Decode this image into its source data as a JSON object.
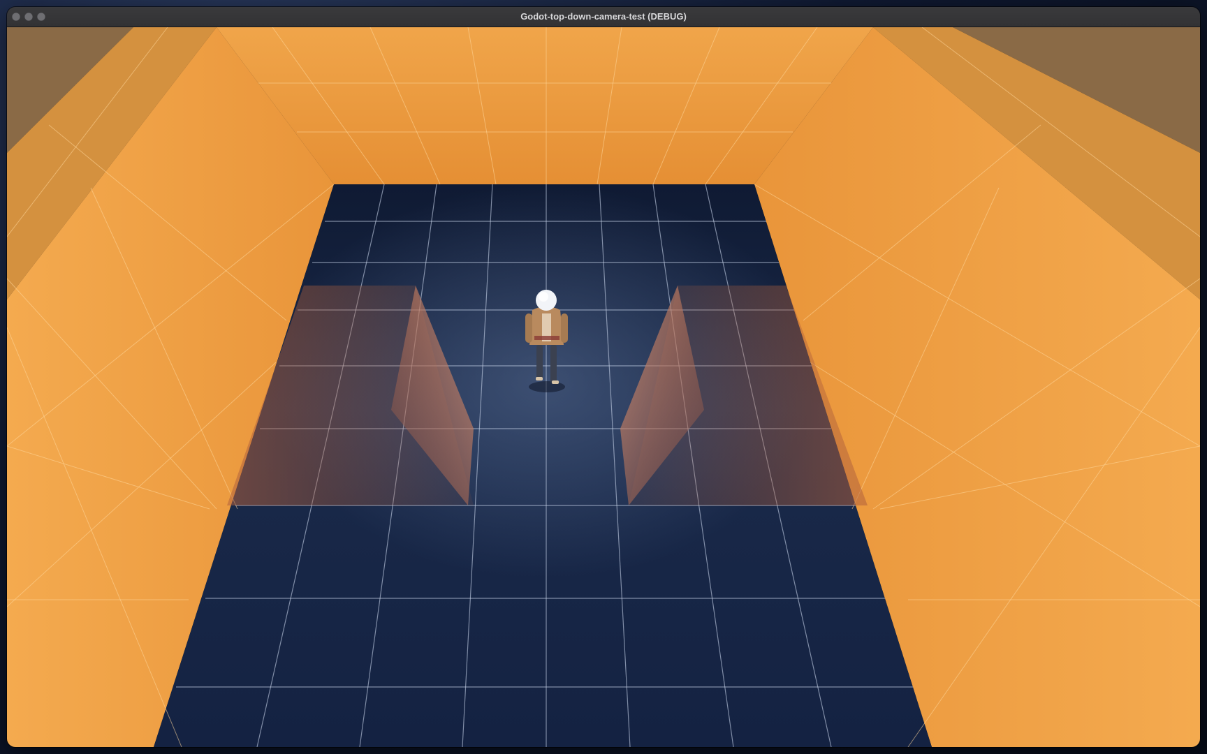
{
  "window": {
    "title": "Godot-top-down-camera-test (DEBUG)",
    "controls": [
      "close-icon",
      "minimize-icon",
      "zoom-icon"
    ]
  },
  "scene": {
    "objects": [
      "back-wall",
      "left-wall",
      "right-wall",
      "floor-grid",
      "left-ramp",
      "right-ramp",
      "player-character"
    ],
    "colors": {
      "wall": "#f2a54a",
      "wall_shadow": "#d88a30",
      "floor": "#162340",
      "grid_line": "#c8d4ea",
      "ramp": "#c98a6e",
      "player_jacket": "#b98a5e",
      "player_hair": "#f2f4f8"
    }
  }
}
